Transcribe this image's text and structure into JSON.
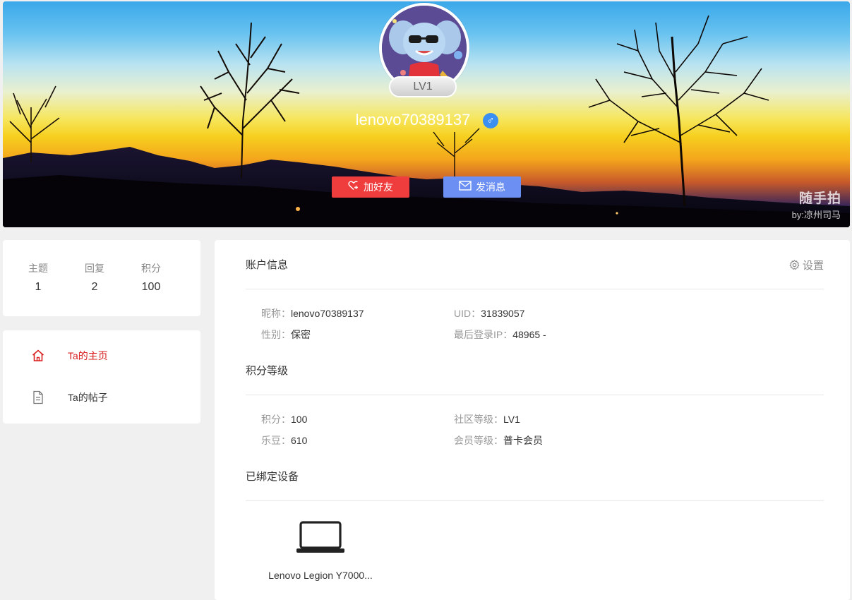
{
  "profile": {
    "username": "lenovo70389137",
    "level_badge": "LV1",
    "gender_symbol": "♂"
  },
  "actions": {
    "add_friend": "加好友",
    "send_message": "发消息"
  },
  "banner": {
    "watermark_title": "随手拍",
    "watermark_credit": "by:凉州司马"
  },
  "stats": [
    {
      "label": "主题",
      "value": "1"
    },
    {
      "label": "回复",
      "value": "2"
    },
    {
      "label": "积分",
      "value": "100"
    }
  ],
  "nav": [
    {
      "label": "Ta的主页",
      "icon": "home-icon",
      "active": true
    },
    {
      "label": "Ta的帖子",
      "icon": "document-icon",
      "active": false
    }
  ],
  "account": {
    "title": "账户信息",
    "settings_label": "设置",
    "nickname_label": "昵称：",
    "nickname": "lenovo70389137",
    "uid_label": "UID：",
    "uid": "31839057",
    "gender_label": "性别：",
    "gender": "保密",
    "ip_label": "最后登录IP：",
    "ip": "48965 -"
  },
  "points": {
    "title": "积分等级",
    "points_label": "积分：",
    "points": "100",
    "level_label": "社区等级：",
    "level": "LV1",
    "beans_label": "乐豆：",
    "beans": "610",
    "member_label": "会员等级：",
    "member": "普卡会员"
  },
  "devices": {
    "title": "已绑定设备",
    "items": [
      {
        "name": "Lenovo Legion Y7000...",
        "icon": "laptop-icon"
      }
    ]
  },
  "colors": {
    "accent_red": "#ef3d3d",
    "message_blue": "#6b8ff2",
    "active_nav": "#d81e1e",
    "gender_blue": "#3a8ff0"
  }
}
